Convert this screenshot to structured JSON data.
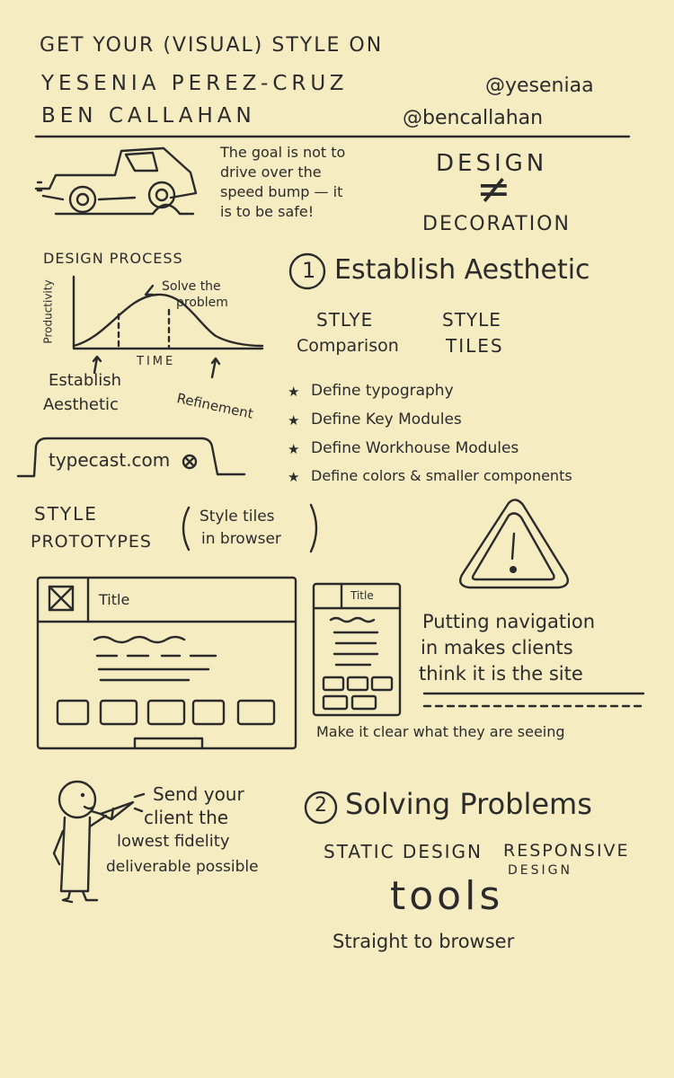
{
  "header": {
    "title": "GET YOUR (VISUAL) STYLE ON",
    "speaker1": "YESENIA PEREZ-CRUZ",
    "handle1": "@yeseniaa",
    "speaker2": "BEN CALLAHAN",
    "handle2": "@bencallahan"
  },
  "truck_note": {
    "line1": "The goal is not to",
    "line2": "drive over the",
    "line3": "speed bump — it",
    "line4": "is to be safe!"
  },
  "design_note": {
    "top": "DESIGN",
    "symbol": "≠",
    "bottom": "DECORATION"
  },
  "process_chart": {
    "title": "DESIGN PROCESS",
    "ylabel": "Productivity",
    "xlabel": "TIME",
    "peak_note_line1": "Solve the",
    "peak_note_line2": "problem",
    "left_note_line1": "Establish",
    "left_note_line2": "Aesthetic",
    "right_note": "Refinement"
  },
  "section1": {
    "number": "1",
    "title": "Establish Aesthetic",
    "col1_line1": "STLYE",
    "col1_line2": "Comparison",
    "col2_line1": "STYLE",
    "col2_line2": "TILES",
    "bullets": [
      "Define typography",
      "Define Key Modules",
      "Define Workhouse Modules",
      "Define colors & smaller components"
    ]
  },
  "tool_tab": {
    "label": "typecast.com"
  },
  "prototypes": {
    "line1": "STYLE",
    "line2": "PROTOTYPES",
    "aside_line1": "Style tiles",
    "aside_line2": "in browser"
  },
  "wireframes": {
    "desktop_title": "Title",
    "mobile_title": "Title"
  },
  "warning_note": {
    "line1": "Putting navigation",
    "line2": "in makes clients",
    "line3": "think it is the site",
    "caption": "Make it clear what they are seeing"
  },
  "fidelity_note": {
    "line1": "Send your",
    "line2": "client the",
    "line3": "lowest fidelity",
    "line4": "deliverable possible"
  },
  "section2": {
    "number": "2",
    "title": "Solving Problems",
    "col1": "STATIC DESIGN",
    "col2_line1": "RESPONSIVE",
    "col2_line2": "DESIGN",
    "tools": "tools",
    "footer": "Straight to browser"
  }
}
